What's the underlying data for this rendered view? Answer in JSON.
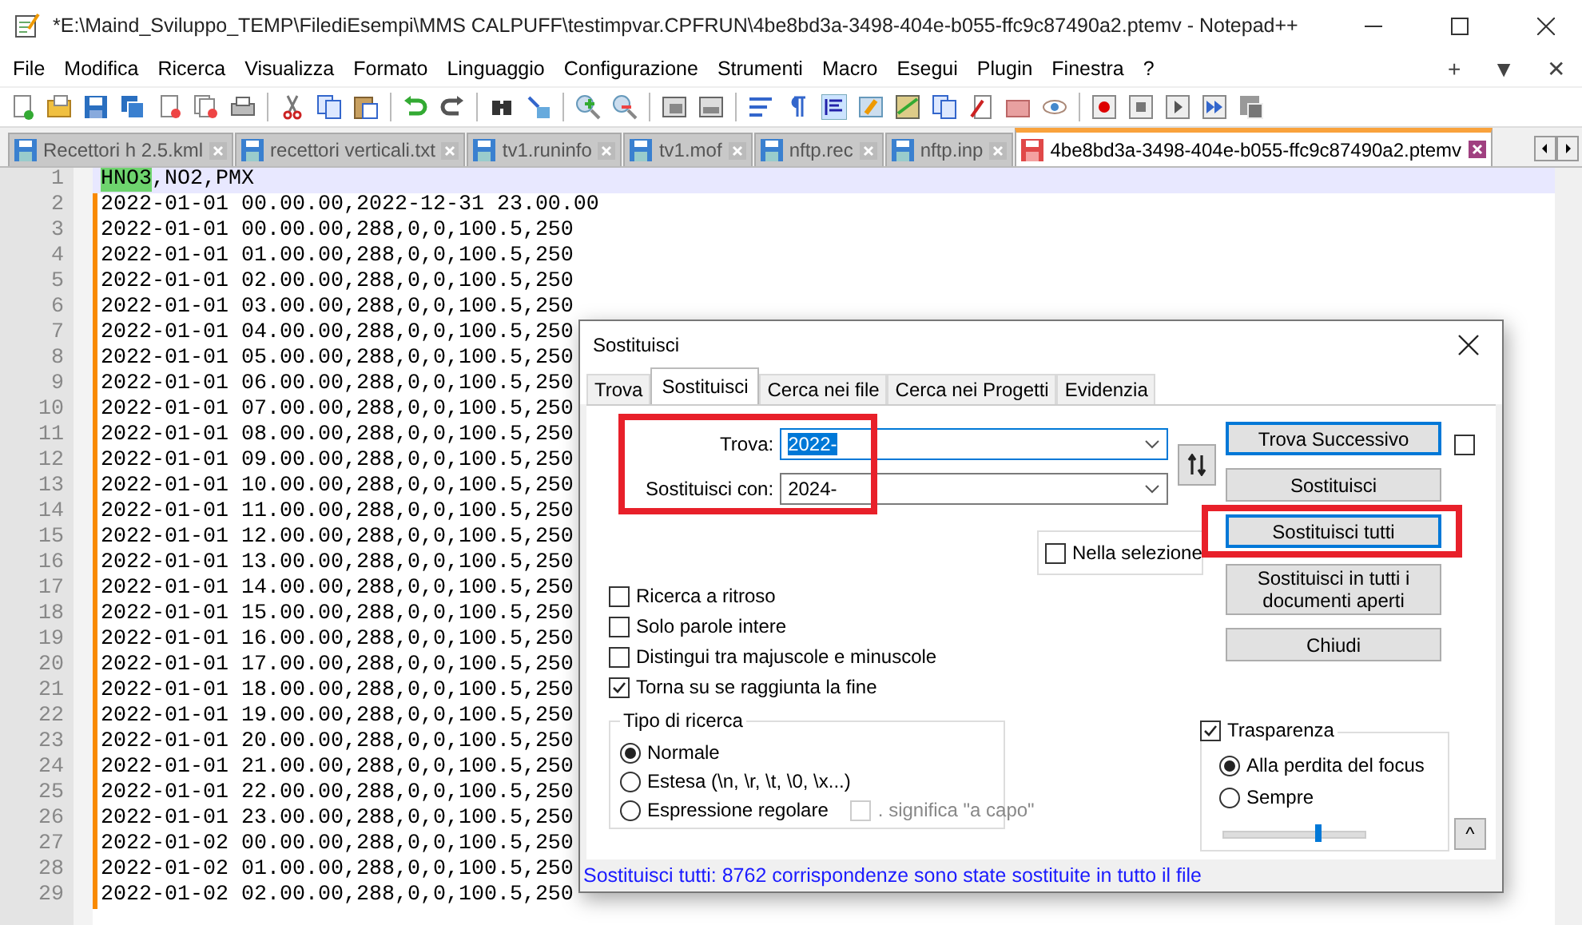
{
  "window": {
    "title": "*E:\\Maind_Sviluppo_TEMP\\FilediEsempi\\MMS CALPUFF\\testimpvar.CPFRUN\\4be8bd3a-3498-404e-b055-ffc9c87490a2.ptemv - Notepad++"
  },
  "menu": [
    "File",
    "Modifica",
    "Ricerca",
    "Visualizza",
    "Formato",
    "Linguaggio",
    "Configurazione",
    "Strumenti",
    "Macro",
    "Esegui",
    "Plugin",
    "Finestra",
    "?"
  ],
  "menu_right": [
    "+",
    "▼",
    "✕"
  ],
  "file_tabs": [
    {
      "label": "Recettori h 2.5.kml",
      "selected": false
    },
    {
      "label": "recettori verticali.txt",
      "selected": false
    },
    {
      "label": "tv1.runinfo",
      "selected": false
    },
    {
      "label": "tv1.mof",
      "selected": false
    },
    {
      "label": "nftp.rec",
      "selected": false
    },
    {
      "label": "nftp.inp",
      "selected": false
    },
    {
      "label": "4be8bd3a-3498-404e-b055-ffc9c87490a2.ptemv",
      "selected": true
    }
  ],
  "editor": {
    "lines": [
      {
        "number": "1",
        "current": true,
        "changed": false,
        "segments": [
          {
            "text": "HNO3",
            "highlighted": true
          },
          {
            "text": ",NO2,PMX",
            "highlighted": false
          }
        ]
      },
      {
        "number": "2",
        "current": false,
        "changed": true,
        "text": "2022-01-01 00.00.00,2022-12-31 23.00.00"
      },
      {
        "number": "3",
        "current": false,
        "changed": true,
        "text": "2022-01-01 00.00.00,288,0,0,100.5,250"
      },
      {
        "number": "4",
        "current": false,
        "changed": true,
        "text": "2022-01-01 01.00.00,288,0,0,100.5,250"
      },
      {
        "number": "5",
        "current": false,
        "changed": true,
        "text": "2022-01-01 02.00.00,288,0,0,100.5,250"
      },
      {
        "number": "6",
        "current": false,
        "changed": true,
        "text": "2022-01-01 03.00.00,288,0,0,100.5,250"
      },
      {
        "number": "7",
        "current": false,
        "changed": true,
        "text": "2022-01-01 04.00.00,288,0,0,100.5,250"
      },
      {
        "number": "8",
        "current": false,
        "changed": true,
        "text": "2022-01-01 05.00.00,288,0,0,100.5,250"
      },
      {
        "number": "9",
        "current": false,
        "changed": true,
        "text": "2022-01-01 06.00.00,288,0,0,100.5,250"
      },
      {
        "number": "10",
        "current": false,
        "changed": true,
        "text": "2022-01-01 07.00.00,288,0,0,100.5,250"
      },
      {
        "number": "11",
        "current": false,
        "changed": true,
        "text": "2022-01-01 08.00.00,288,0,0,100.5,250"
      },
      {
        "number": "12",
        "current": false,
        "changed": true,
        "text": "2022-01-01 09.00.00,288,0,0,100.5,250"
      },
      {
        "number": "13",
        "current": false,
        "changed": true,
        "text": "2022-01-01 10.00.00,288,0,0,100.5,250"
      },
      {
        "number": "14",
        "current": false,
        "changed": true,
        "text": "2022-01-01 11.00.00,288,0,0,100.5,250"
      },
      {
        "number": "15",
        "current": false,
        "changed": true,
        "text": "2022-01-01 12.00.00,288,0,0,100.5,250"
      },
      {
        "number": "16",
        "current": false,
        "changed": true,
        "text": "2022-01-01 13.00.00,288,0,0,100.5,250"
      },
      {
        "number": "17",
        "current": false,
        "changed": true,
        "text": "2022-01-01 14.00.00,288,0,0,100.5,250"
      },
      {
        "number": "18",
        "current": false,
        "changed": true,
        "text": "2022-01-01 15.00.00,288,0,0,100.5,250"
      },
      {
        "number": "19",
        "current": false,
        "changed": true,
        "text": "2022-01-01 16.00.00,288,0,0,100.5,250"
      },
      {
        "number": "20",
        "current": false,
        "changed": true,
        "text": "2022-01-01 17.00.00,288,0,0,100.5,250"
      },
      {
        "number": "21",
        "current": false,
        "changed": true,
        "text": "2022-01-01 18.00.00,288,0,0,100.5,250"
      },
      {
        "number": "22",
        "current": false,
        "changed": true,
        "text": "2022-01-01 19.00.00,288,0,0,100.5,250"
      },
      {
        "number": "23",
        "current": false,
        "changed": true,
        "text": "2022-01-01 20.00.00,288,0,0,100.5,250"
      },
      {
        "number": "24",
        "current": false,
        "changed": true,
        "text": "2022-01-01 21.00.00,288,0,0,100.5,250"
      },
      {
        "number": "25",
        "current": false,
        "changed": true,
        "text": "2022-01-01 22.00.00,288,0,0,100.5,250"
      },
      {
        "number": "26",
        "current": false,
        "changed": true,
        "text": "2022-01-01 23.00.00,288,0,0,100.5,250"
      },
      {
        "number": "27",
        "current": false,
        "changed": true,
        "text": "2022-01-02 00.00.00,288,0,0,100.5,250"
      },
      {
        "number": "28",
        "current": false,
        "changed": true,
        "text": "2022-01-02 01.00.00,288,0,0,100.5,250"
      },
      {
        "number": "29",
        "current": false,
        "changed": true,
        "text": "2022-01-02 02.00.00,288,0,0,100.5,250"
      }
    ]
  },
  "dialog": {
    "title": "Sostituisci",
    "tabs": [
      {
        "label": "Trova",
        "selected": false
      },
      {
        "label": "Sostituisci",
        "selected": true
      },
      {
        "label": "Cerca nei file",
        "selected": false
      },
      {
        "label": "Cerca nei Progetti",
        "selected": false
      },
      {
        "label": "Evidenzia",
        "selected": false
      }
    ],
    "find": {
      "label": "Trova:",
      "value": "2022-",
      "value_selected": true
    },
    "replace": {
      "label": "Sostituisci con:",
      "value": "2024-",
      "value_selected": false
    },
    "in_selection": {
      "label": "Nella selezione",
      "checked": false
    },
    "buttons": [
      {
        "label": "Trova Successivo",
        "focused": true
      },
      {
        "label": "Sostituisci",
        "focused": false
      },
      {
        "label": "Sostituisci tutti",
        "focused": true
      },
      {
        "label": "Sostituisci in tutti i documenti aperti",
        "focused": false
      },
      {
        "label": "Chiudi",
        "focused": false
      }
    ],
    "find_next_option": {
      "checked": false
    },
    "options": [
      {
        "label": "Ricerca a ritroso",
        "checked": false
      },
      {
        "label": "Solo parole intere",
        "checked": false
      },
      {
        "label": "Distingui tra majuscole e minuscole",
        "checked": false
      },
      {
        "label": "Torna su se raggiunta la fine",
        "checked": true
      }
    ],
    "search_mode": {
      "title": "Tipo di ricerca",
      "options": [
        {
          "label": "Normale",
          "selected": true
        },
        {
          "label": "Estesa (\\n, \\r, \\t, \\0, \\x...)",
          "selected": false
        },
        {
          "label": "Espressione regolare",
          "selected": false
        }
      ],
      "dot_newline": {
        "label": ". significa \"a capo\"",
        "checked": false,
        "disabled": true
      }
    },
    "transparency": {
      "label": "Trasparenza",
      "checked": true,
      "options": [
        {
          "label": "Alla perdita del focus",
          "selected": true
        },
        {
          "label": "Sempre",
          "selected": false
        }
      ],
      "level": 0.65
    },
    "collapse": "^",
    "status": "Sostituisci tutti: 8762 corrispondenze sono state sostituite in tutto il file"
  }
}
